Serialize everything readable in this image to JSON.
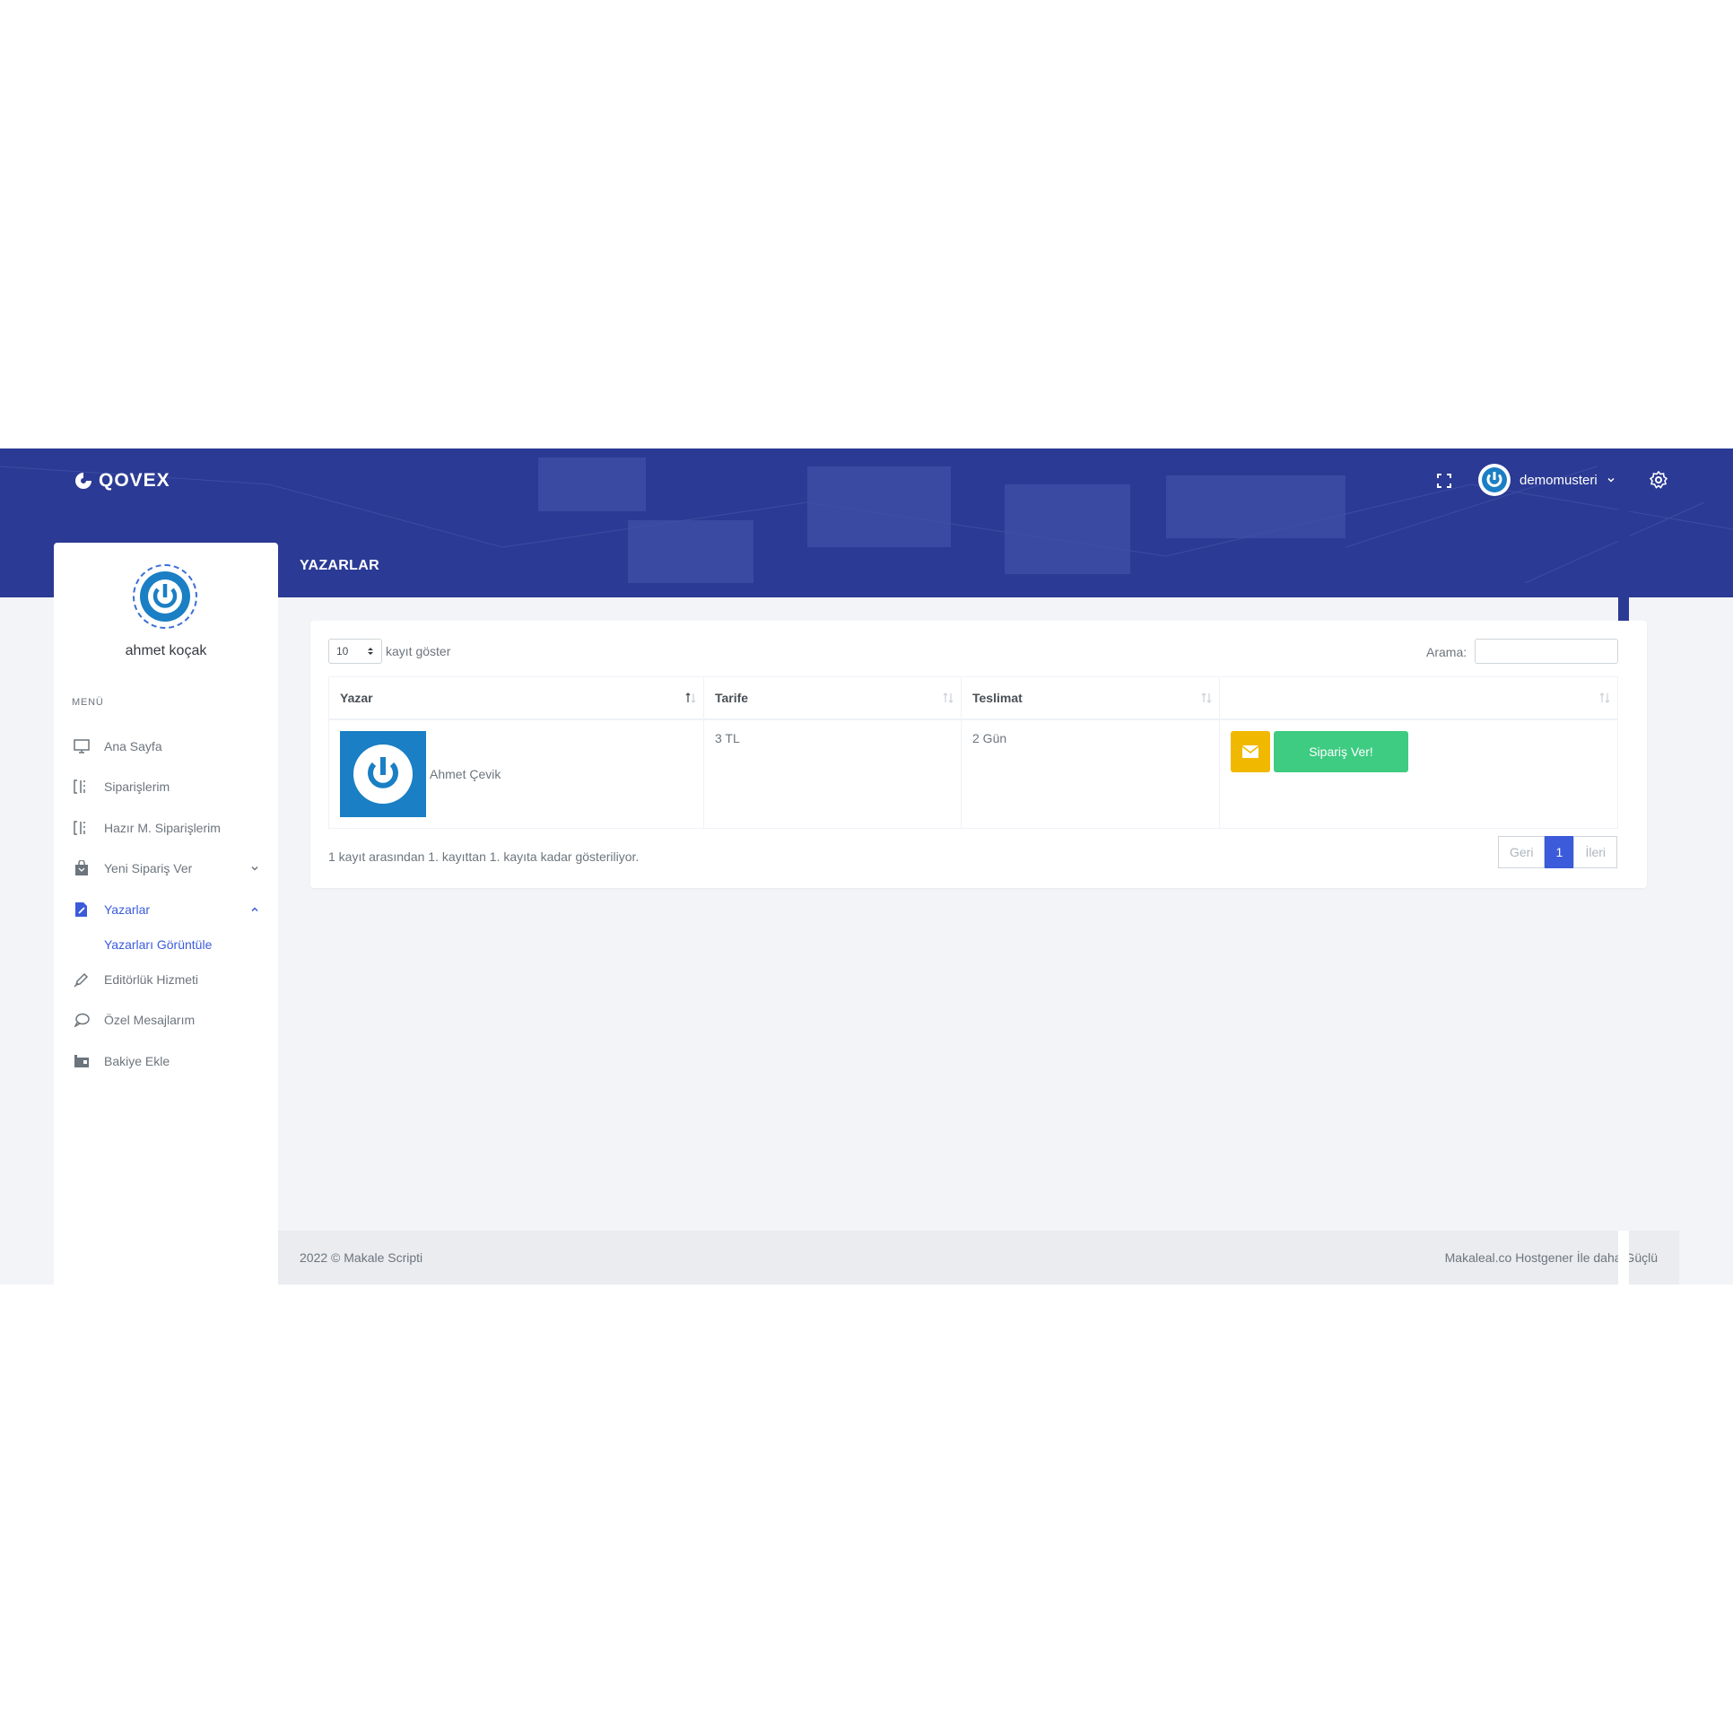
{
  "brand": {
    "name": "QOVEX",
    "icon": "qovex-logo-icon"
  },
  "header": {
    "username": "demomusteri",
    "fullscreen_icon": "fullscreen-icon",
    "settings_icon": "gear-icon",
    "page_title": "YAZARLAR"
  },
  "colors": {
    "header": "#2b3a94",
    "accent": "#3b5bdb",
    "success": "#3ecb82",
    "warning": "#f1b800"
  },
  "sidebar": {
    "profile_name": "ahmet koçak",
    "menu_title": "MENÜ",
    "items": [
      {
        "label": "Ana Sayfa",
        "icon": "monitor-icon"
      },
      {
        "label": "Siparişlerim",
        "icon": "columns-icon"
      },
      {
        "label": "Hazır M. Siparişlerim",
        "icon": "columns-icon"
      },
      {
        "label": "Yeni Sipariş Ver",
        "icon": "shopping-bag-icon"
      },
      {
        "label": "Yazarlar",
        "icon": "file-edit-icon"
      },
      {
        "label": "Editörlük Hizmeti",
        "icon": "pen-icon"
      },
      {
        "label": "Özel Mesajlarım",
        "icon": "chat-icon"
      },
      {
        "label": "Bakiye Ekle",
        "icon": "wallet-icon"
      }
    ],
    "subitem": "Yazarları Görüntüle"
  },
  "table": {
    "length_value": "10",
    "length_label": "kayıt göster",
    "search_label": "Arama:",
    "columns": [
      "Yazar",
      "Tarife",
      "Teslimat",
      ""
    ],
    "rows": [
      {
        "author": "Ahmet Çevik",
        "tarife": "3 TL",
        "teslimat": "2 Gün",
        "order_label": "Sipariş Ver!"
      }
    ],
    "info": "1 kayıt arasından 1. kayıttan 1. kayıta kadar gösteriliyor.",
    "pager": {
      "prev": "Geri",
      "current": "1",
      "next": "İleri"
    }
  },
  "footer": {
    "left": "2022 © Makale Scripti",
    "right": "Makaleal.co Hostgener İle daha Güçlü"
  }
}
